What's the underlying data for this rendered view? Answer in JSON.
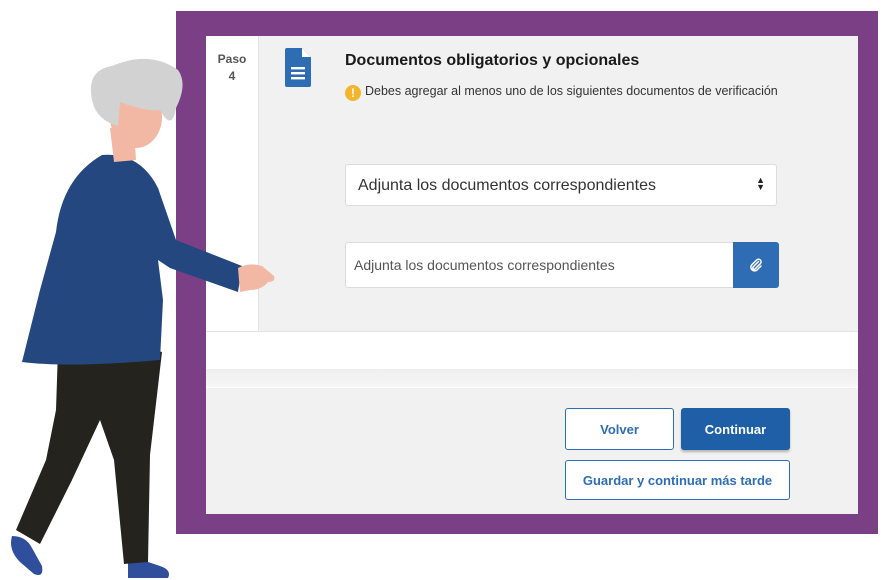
{
  "step": {
    "label": "Paso",
    "number": "4"
  },
  "section": {
    "title": "Documentos obligatorios y opcionales",
    "warning": "Debes agregar al menos uno de los siguientes documentos de verificación"
  },
  "document_select": {
    "value": "Adjunta los documentos correspondientes"
  },
  "file_input": {
    "placeholder": "Adjunta los documentos correspondientes"
  },
  "buttons": {
    "back": "Volver",
    "continue": "Continuar",
    "save_later": "Guardar y continuar más tarde"
  },
  "colors": {
    "frame": "#7b3f86",
    "primary": "#2e6db4",
    "warning": "#f2b52b",
    "panel_gray": "#f1f1f1"
  },
  "icons": [
    "document-icon",
    "warning-icon",
    "select-arrows-icon",
    "paperclip-icon"
  ]
}
